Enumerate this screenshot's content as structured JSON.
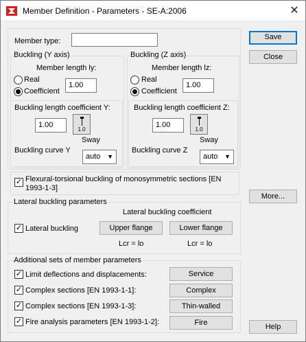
{
  "window": {
    "title": "Member Definition - Parameters - SE-A:2006",
    "close_glyph": "✕"
  },
  "member_type": {
    "label": "Member type:",
    "value": ""
  },
  "buttons": {
    "save": "Save",
    "close": "Close",
    "more": "More...",
    "help": "Help"
  },
  "buckling_y": {
    "group_label": "Buckling (Y axis)",
    "length_label": "Member length ly:",
    "real_label": "Real",
    "coefficient_label": "Coefficient",
    "selected": "coefficient",
    "length_value": "1.00",
    "coef_label": "Buckling length coefficient Y:",
    "coef_value": "1.00",
    "sway_value": "1.0",
    "sway_label": "Sway",
    "curve_label": "Buckling curve  Y",
    "curve_value": "auto"
  },
  "buckling_z": {
    "group_label": "Buckling (Z axis)",
    "length_label": "Member length lz:",
    "real_label": "Real",
    "coefficient_label": "Coefficient",
    "selected": "coefficient",
    "length_value": "1.00",
    "coef_label": "Buckling length coefficient Z:",
    "coef_value": "1.00",
    "sway_value": "1.0",
    "sway_label": "Sway",
    "curve_label": "Buckling curve  Z",
    "curve_value": "auto"
  },
  "flexural": {
    "checked": true,
    "label_line1": "Flexural-torsional buckling of monosymmetric sections [EN",
    "label_line2": "1993-1-3]"
  },
  "lateral": {
    "group_label": "Lateral buckling parameters",
    "coef_header": "Lateral buckling coefficient",
    "checkbox_label": "Lateral buckling",
    "checked": true,
    "upper_flange": "Upper flange",
    "lower_flange": "Lower flange",
    "lcr_upper": "Lcr  =  lo",
    "lcr_lower": "Lcr  =  lo"
  },
  "additional": {
    "group_label": "Additional sets of member parameters",
    "rows": [
      {
        "label": "Limit deflections and displacements:",
        "checked": true,
        "button": "Service"
      },
      {
        "label": "Complex sections [EN 1993-1-1]:",
        "checked": true,
        "button": "Complex"
      },
      {
        "label": "Complex sections [EN 1993-1-3]:",
        "checked": true,
        "button": "Thin-walled"
      },
      {
        "label": "Fire analysis parameters [EN 1993-1-2]:",
        "checked": true,
        "button": "Fire"
      }
    ]
  },
  "colors": {
    "accent": "#0078d7",
    "dialog_bg": "#f0f0f0",
    "logo_red": "#d42020"
  }
}
